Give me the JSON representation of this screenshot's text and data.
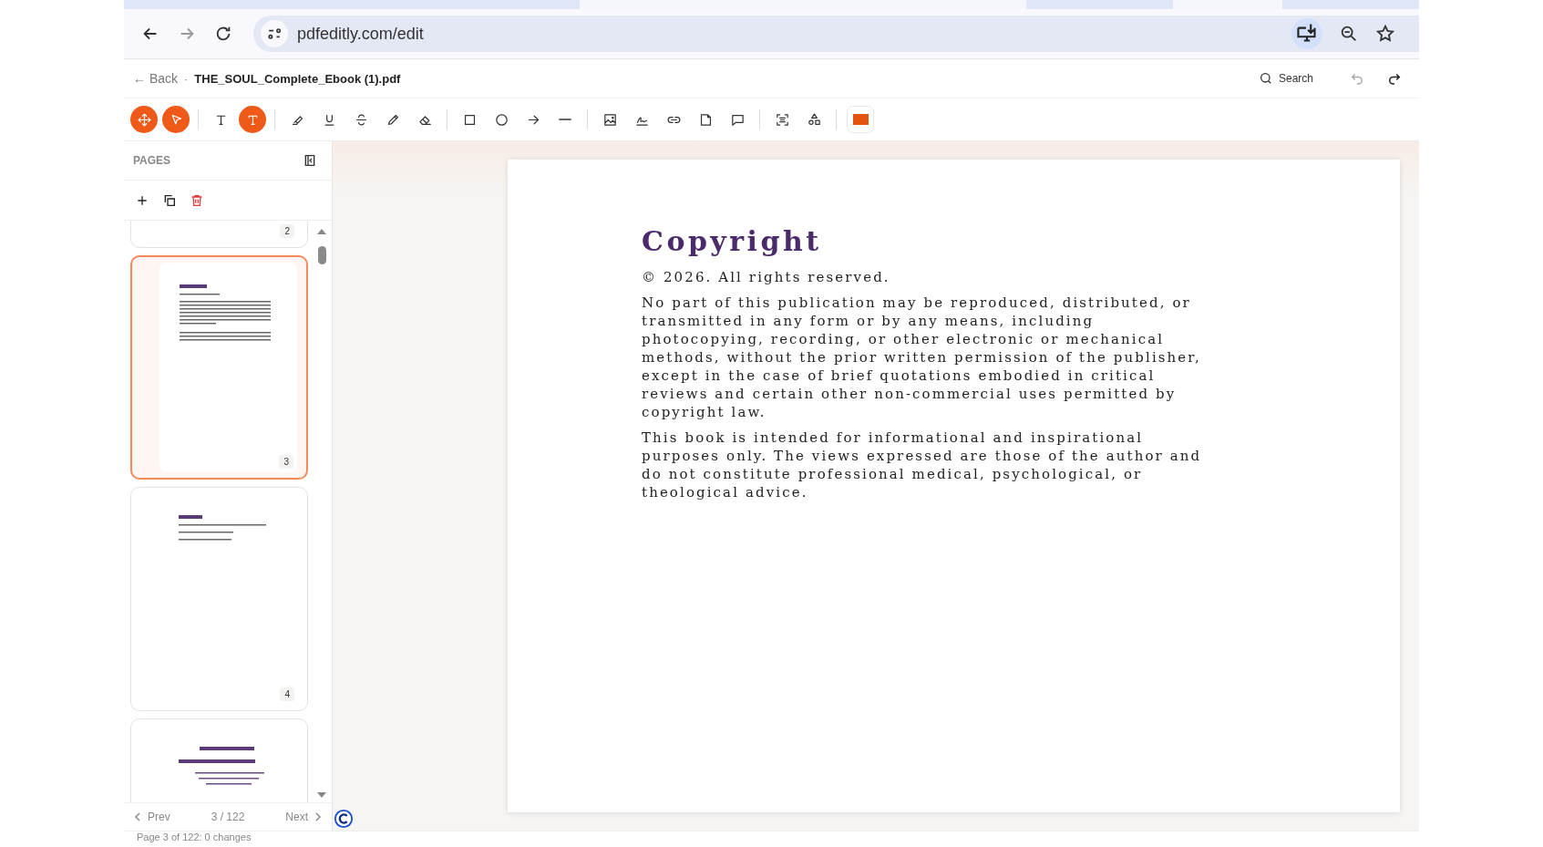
{
  "browser": {
    "url": "pdfeditly.com/edit"
  },
  "header": {
    "back": "← Back",
    "separator": "·",
    "filename": "THE_SOUL_Complete_Ebook (1).pdf",
    "search": "Search",
    "undo_disabled": true
  },
  "toolbar": {
    "tools": [
      {
        "selected": true
      },
      {
        "selected": true
      },
      {
        "selected": false
      },
      {
        "selected": true
      },
      {
        "selected": false
      },
      {
        "selected": false
      },
      {
        "selected": false
      },
      {
        "selected": false
      },
      {
        "selected": false
      },
      {
        "selected": false
      },
      {
        "selected": false
      },
      {
        "selected": false
      },
      {
        "selected": false
      },
      {
        "selected": false
      },
      {
        "selected": false
      },
      {
        "selected": false
      },
      {
        "selected": false
      },
      {
        "selected": false
      },
      {
        "selected": false
      },
      {
        "selected": false
      }
    ]
  },
  "sidebar": {
    "title": "PAGES",
    "pages": [
      {
        "number": "2",
        "selected": false
      },
      {
        "number": "3",
        "selected": true
      },
      {
        "number": "4",
        "selected": false
      },
      {
        "selected": false
      }
    ],
    "prev": "Prev",
    "position": "3 / 122",
    "next": "Next"
  },
  "status_bar": "Page 3 of 122: 0 changes",
  "document": {
    "heading": "Copyright",
    "notice": "© 2026. All rights reserved.",
    "paragraphs": [
      "No part of this publication may be reproduced, distributed, or transmitted in any form or by any means, including photocopying, recording, or other electronic or mechanical methods, without the prior written permission of the publisher, except in the case of brief quotations embodied in critical reviews and certain other non-commercial uses permitted by copyright law.",
      "This book is intended for informational and inspirational purposes only. The views expressed are those of the author and do not constitute professional medical, psychological, or theological advice."
    ]
  }
}
